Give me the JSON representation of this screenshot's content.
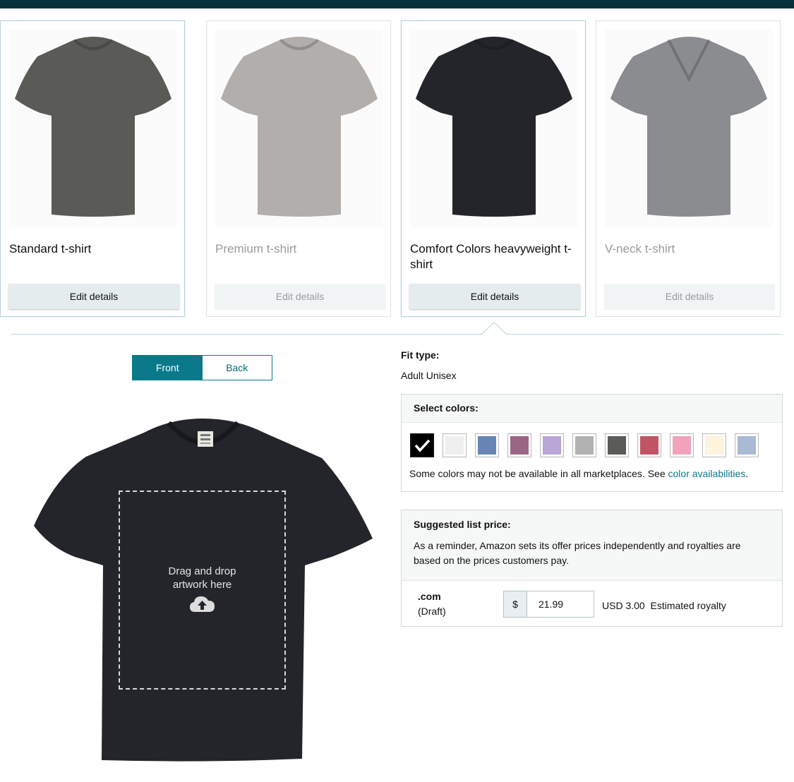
{
  "products": [
    {
      "title": "Standard t-shirt",
      "edit_label": "Edit details",
      "state": "selected",
      "shirt_color": "#5a5a56",
      "neck": "crew"
    },
    {
      "title": "Premium t-shirt",
      "edit_label": "Edit details",
      "state": "dim",
      "shirt_color": "#b1aeab",
      "neck": "crew"
    },
    {
      "title": "Comfort Colors heavyweight t-shirt",
      "edit_label": "Edit details",
      "state": "selected",
      "shirt_color": "#23252a",
      "neck": "crew"
    },
    {
      "title": "V-neck t-shirt",
      "edit_label": "Edit details",
      "state": "dim",
      "shirt_color": "#8b8c8f",
      "neck": "v"
    }
  ],
  "side_toggle": {
    "front_label": "Front",
    "back_label": "Back",
    "active": "front"
  },
  "preview": {
    "shirt_color": "#23252a",
    "drop_line1": "Drag and drop",
    "drop_line2": "artwork here",
    "icon": "cloud-upload-icon"
  },
  "fit": {
    "label": "Fit type:",
    "value": "Adult Unisex"
  },
  "colors": {
    "title": "Select colors:",
    "swatches": [
      {
        "name": "Black",
        "color": "#000000",
        "selected": true
      },
      {
        "name": "White",
        "color": "#efefef",
        "selected": false
      },
      {
        "name": "Blue",
        "color": "#6786b3",
        "selected": false
      },
      {
        "name": "Purple",
        "color": "#9a6683",
        "selected": false
      },
      {
        "name": "Lavender Tie-Dye",
        "color": "#b9a6d6",
        "selected": false
      },
      {
        "name": "Grey Tie-Dye",
        "color": "#b2b2b2",
        "selected": false
      },
      {
        "name": "Charcoal",
        "color": "#5b5c5a",
        "selected": false
      },
      {
        "name": "Red",
        "color": "#c35466",
        "selected": false
      },
      {
        "name": "Pink",
        "color": "#f2a2bb",
        "selected": false
      },
      {
        "name": "Cream",
        "color": "#fcf4dc",
        "selected": false
      },
      {
        "name": "Blue Tie-Dye",
        "color": "#a9bad5",
        "selected": false
      }
    ],
    "note": "Some colors may not be available in all marketplaces. See ",
    "link": "color availabilities",
    "note_end": "."
  },
  "pricing": {
    "title": "Suggested list price:",
    "description": "As a reminder, Amazon sets its offer prices independently and royalties are based on the prices customers pay.",
    "marketplace": ".com",
    "status": "(Draft)",
    "currency_symbol": "$",
    "price": "21.99",
    "royalty": "USD 3.00",
    "royalty_label": "Estimated royalty"
  },
  "theme": {
    "accent": "#0a7a8a",
    "topbar": "#06303a"
  }
}
